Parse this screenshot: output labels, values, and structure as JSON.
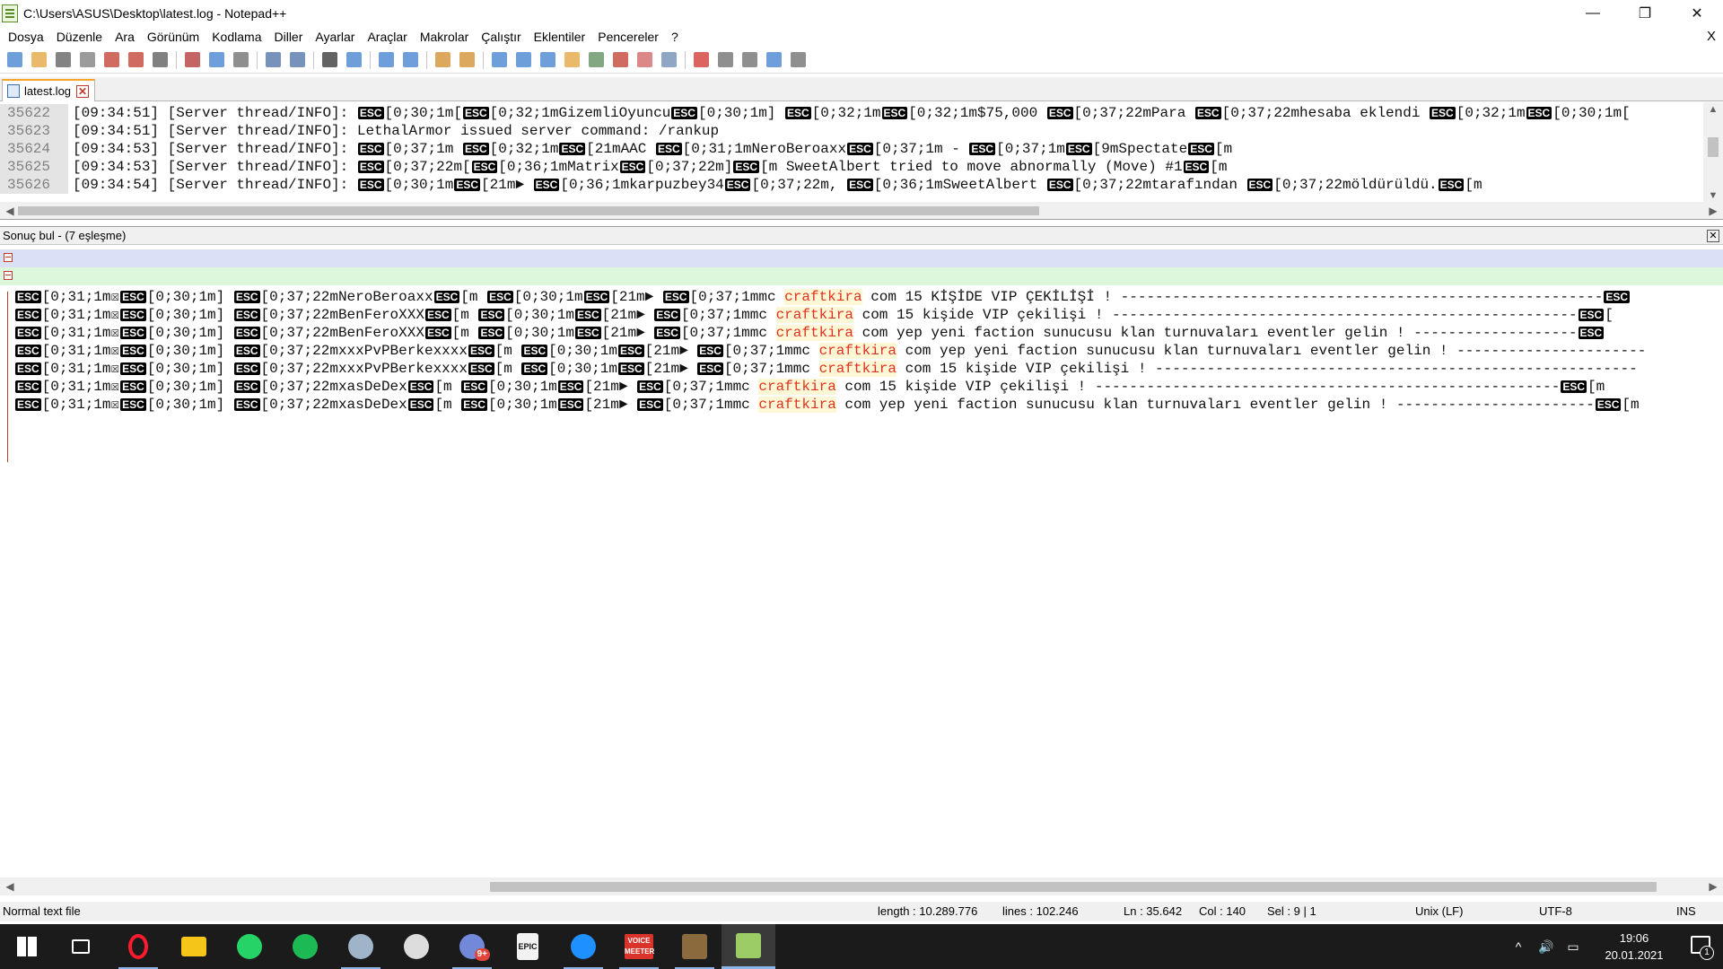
{
  "window": {
    "title": "C:\\Users\\ASUS\\Desktop\\latest.log - Notepad++",
    "minimize": "—",
    "maximize": "❐",
    "close": "✕"
  },
  "menu": {
    "items": [
      "Dosya",
      "Düzenle",
      "Ara",
      "Görünüm",
      "Kodlama",
      "Diller",
      "Ayarlar",
      "Araçlar",
      "Makrolar",
      "Çalıştır",
      "Eklentiler",
      "Pencereler",
      "?"
    ],
    "close_doc": "X"
  },
  "toolbar": {
    "icons": [
      "new-file-icon",
      "open-file-icon",
      "save-icon",
      "save-all-icon",
      "close-icon",
      "close-all-icon",
      "print-icon",
      "cut-icon",
      "copy-icon",
      "paste-icon",
      "undo-icon",
      "redo-icon",
      "find-icon",
      "replace-icon",
      "zoom-in-icon",
      "zoom-out-icon",
      "sync-vertical-icon",
      "sync-horizontal-icon",
      "word-wrap-icon",
      "show-all-chars-icon",
      "indent-guide-icon",
      "udl-icon",
      "doc-map-icon",
      "function-list-icon",
      "folder-as-workspace-icon",
      "monitoring-icon",
      "record-macro-icon",
      "stop-macro-icon",
      "play-macro-icon",
      "run-macro-multiple-icon",
      "save-macro-icon"
    ]
  },
  "tab": {
    "label": "latest.log",
    "close": "✕"
  },
  "editor": {
    "esc": "ESC",
    "lines": [
      {
        "num": "35622",
        "segments": [
          "[09:34:51] [Server thread/INFO]: ",
          "@",
          "[0;30;1m[",
          "@",
          "[0;32;1mGizemliOyuncu",
          "@",
          "[0;30;1m] ",
          "@",
          "[0;32;1m",
          "@",
          "[0;32;1m$75,000 ",
          "@",
          "[0;37;22mPara ",
          "@",
          "[0;37;22mhesaba eklendi ",
          "@",
          "[0;32;1m",
          "@",
          "[0;30;1m["
        ]
      },
      {
        "num": "35623",
        "segments": [
          "[09:34:51] [Server thread/INFO]: LethalArmor issued server command: /rankup"
        ]
      },
      {
        "num": "35624",
        "segments": [
          "[09:34:53] [Server thread/INFO]: ",
          "@",
          "[0;37;1m ",
          "@",
          "[0;32;1m",
          "@",
          "[21mAAC ",
          "@",
          "[0;31;1mNeroBeroaxx",
          "@",
          "[0;37;1m - ",
          "@",
          "[0;37;1m",
          "@",
          "[9mSpectate",
          "@",
          "[m"
        ]
      },
      {
        "num": "35625",
        "segments": [
          "[09:34:53] [Server thread/INFO]: ",
          "@",
          "[0;37;22m[",
          "@",
          "[0;36;1mMatrix",
          "@",
          "[0;37;22m]",
          "@",
          "[m SweetAlbert tried to move abnormally (Move) #1",
          "@",
          "[m"
        ]
      },
      {
        "num": "35626",
        "segments": [
          "[09:34:54] [Server thread/INFO]: ",
          "@",
          "[0;30;1m",
          "@",
          "[21m► ",
          "@",
          "[0;36;1mkarpuzbey34",
          "@",
          "[0;37;22m, ",
          "@",
          "[0;36;1mSweetAlbert ",
          "@",
          "[0;37;22mtarafından ",
          "@",
          "[0;37;22möldürüldü.",
          "@",
          "[m"
        ]
      }
    ]
  },
  "find_panel": {
    "title": "Sonuç bul - (7 eşleşme)",
    "close": "✕",
    "lines": [
      {
        "before": [
          "@",
          "[0;31;1m☒",
          "@",
          "[0;30;1m] ",
          "@",
          "[0;37;22mNeroBeroaxx",
          "@",
          "[m ",
          "@",
          "[0;30;1m",
          "@",
          "[21m► ",
          "@",
          "[0;37;1mmc "
        ],
        "match": "craftkira",
        "after": [
          " com 15 KİŞİDE VIP ÇEKİLİŞİ ! --------------------------------------------------------",
          "@"
        ]
      },
      {
        "before": [
          "@",
          "[0;31;1m☒",
          "@",
          "[0;30;1m] ",
          "@",
          "[0;37;22mBenFeroXXX",
          "@",
          "[m ",
          "@",
          "[0;30;1m",
          "@",
          "[21m► ",
          "@",
          "[0;37;1mmc "
        ],
        "match": "craftkira",
        "after": [
          " com 15 kişide VIP çekilişi ! ------------------------------------------------------",
          "@",
          "["
        ]
      },
      {
        "before": [
          "@",
          "[0;31;1m☒",
          "@",
          "[0;30;1m] ",
          "@",
          "[0;37;22mBenFeroXXX",
          "@",
          "[m ",
          "@",
          "[0;30;1m",
          "@",
          "[21m► ",
          "@",
          "[0;37;1mmc "
        ],
        "match": "craftkira",
        "after": [
          " com yep yeni faction sunucusu klan turnuvaları eventler gelin ! -------------------",
          "@"
        ]
      },
      {
        "before": [
          "@",
          "[0;31;1m☒",
          "@",
          "[0;30;1m] ",
          "@",
          "[0;37;22mxxxPvPBerkexxxx",
          "@",
          "[m ",
          "@",
          "[0;30;1m",
          "@",
          "[21m► ",
          "@",
          "[0;37;1mmc "
        ],
        "match": "craftkira",
        "after": [
          " com yep yeni faction sunucusu klan turnuvaları eventler gelin ! ----------------------"
        ]
      },
      {
        "before": [
          "@",
          "[0;31;1m☒",
          "@",
          "[0;30;1m] ",
          "@",
          "[0;37;22mxxxPvPBerkexxxx",
          "@",
          "[m ",
          "@",
          "[0;30;1m",
          "@",
          "[21m► ",
          "@",
          "[0;37;1mmc "
        ],
        "match": "craftkira",
        "after": [
          " com 15 kişide VIP çekilişi ! --------------------------------------------------------"
        ]
      },
      {
        "before": [
          "@",
          "[0;31;1m☒",
          "@",
          "[0;30;1m] ",
          "@",
          "[0;37;22mxasDeDex",
          "@",
          "[m ",
          "@",
          "[0;30;1m",
          "@",
          "[21m► ",
          "@",
          "[0;37;1mmc "
        ],
        "match": "craftkira",
        "after": [
          " com 15 kişide VIP çekilişi ! ------------------------------------------------------",
          "@",
          "[m"
        ]
      },
      {
        "before": [
          "@",
          "[0;31;1m☒",
          "@",
          "[0;30;1m] ",
          "@",
          "[0;37;22mxasDeDex",
          "@",
          "[m ",
          "@",
          "[0;30;1m",
          "@",
          "[21m► ",
          "@",
          "[0;37;1mmc "
        ],
        "match": "craftkira",
        "after": [
          " com yep yeni faction sunucusu klan turnuvaları eventler gelin ! -----------------------",
          "@",
          "[m"
        ]
      }
    ]
  },
  "status": {
    "type": "Normal text file",
    "length": "length : 10.289.776",
    "lines": "lines : 102.246",
    "ln": "Ln : 35.642",
    "col": "Col : 140",
    "sel": "Sel : 9 | 1",
    "eol": "Unix (LF)",
    "encoding": "UTF-8",
    "mode": "INS"
  },
  "taskbar": {
    "apps": [
      {
        "name": "start-icon",
        "color": "#ffffff"
      },
      {
        "name": "task-view-icon",
        "color": "#ffffff"
      },
      {
        "name": "opera-icon",
        "color": "#ff1b2d"
      },
      {
        "name": "file-explorer-icon",
        "color": "#f5c518"
      },
      {
        "name": "whatsapp-icon",
        "color": "#25d366"
      },
      {
        "name": "spotify-icon",
        "color": "#1db954"
      },
      {
        "name": "steam-icon",
        "color": "#9fb4c8"
      },
      {
        "name": "obs-icon",
        "color": "#dddddd"
      },
      {
        "name": "discord-icon",
        "color": "#7289da"
      },
      {
        "name": "epic-games-icon",
        "color": "#2a2a2a"
      },
      {
        "name": "headset-icon",
        "color": "#1e90ff"
      },
      {
        "name": "voicemeeter-icon",
        "color": "#d9342b"
      },
      {
        "name": "minecraft-icon",
        "color": "#8b6a3e"
      },
      {
        "name": "notepadpp-icon",
        "color": "#9ccc65"
      }
    ],
    "discord_badge": "9+",
    "epic_label": "EPIC",
    "voicemeeter_label": "VOICE MEETER",
    "tray_chevron": "^",
    "time": "19:06",
    "date": "20.01.2021",
    "notifications": "1"
  }
}
